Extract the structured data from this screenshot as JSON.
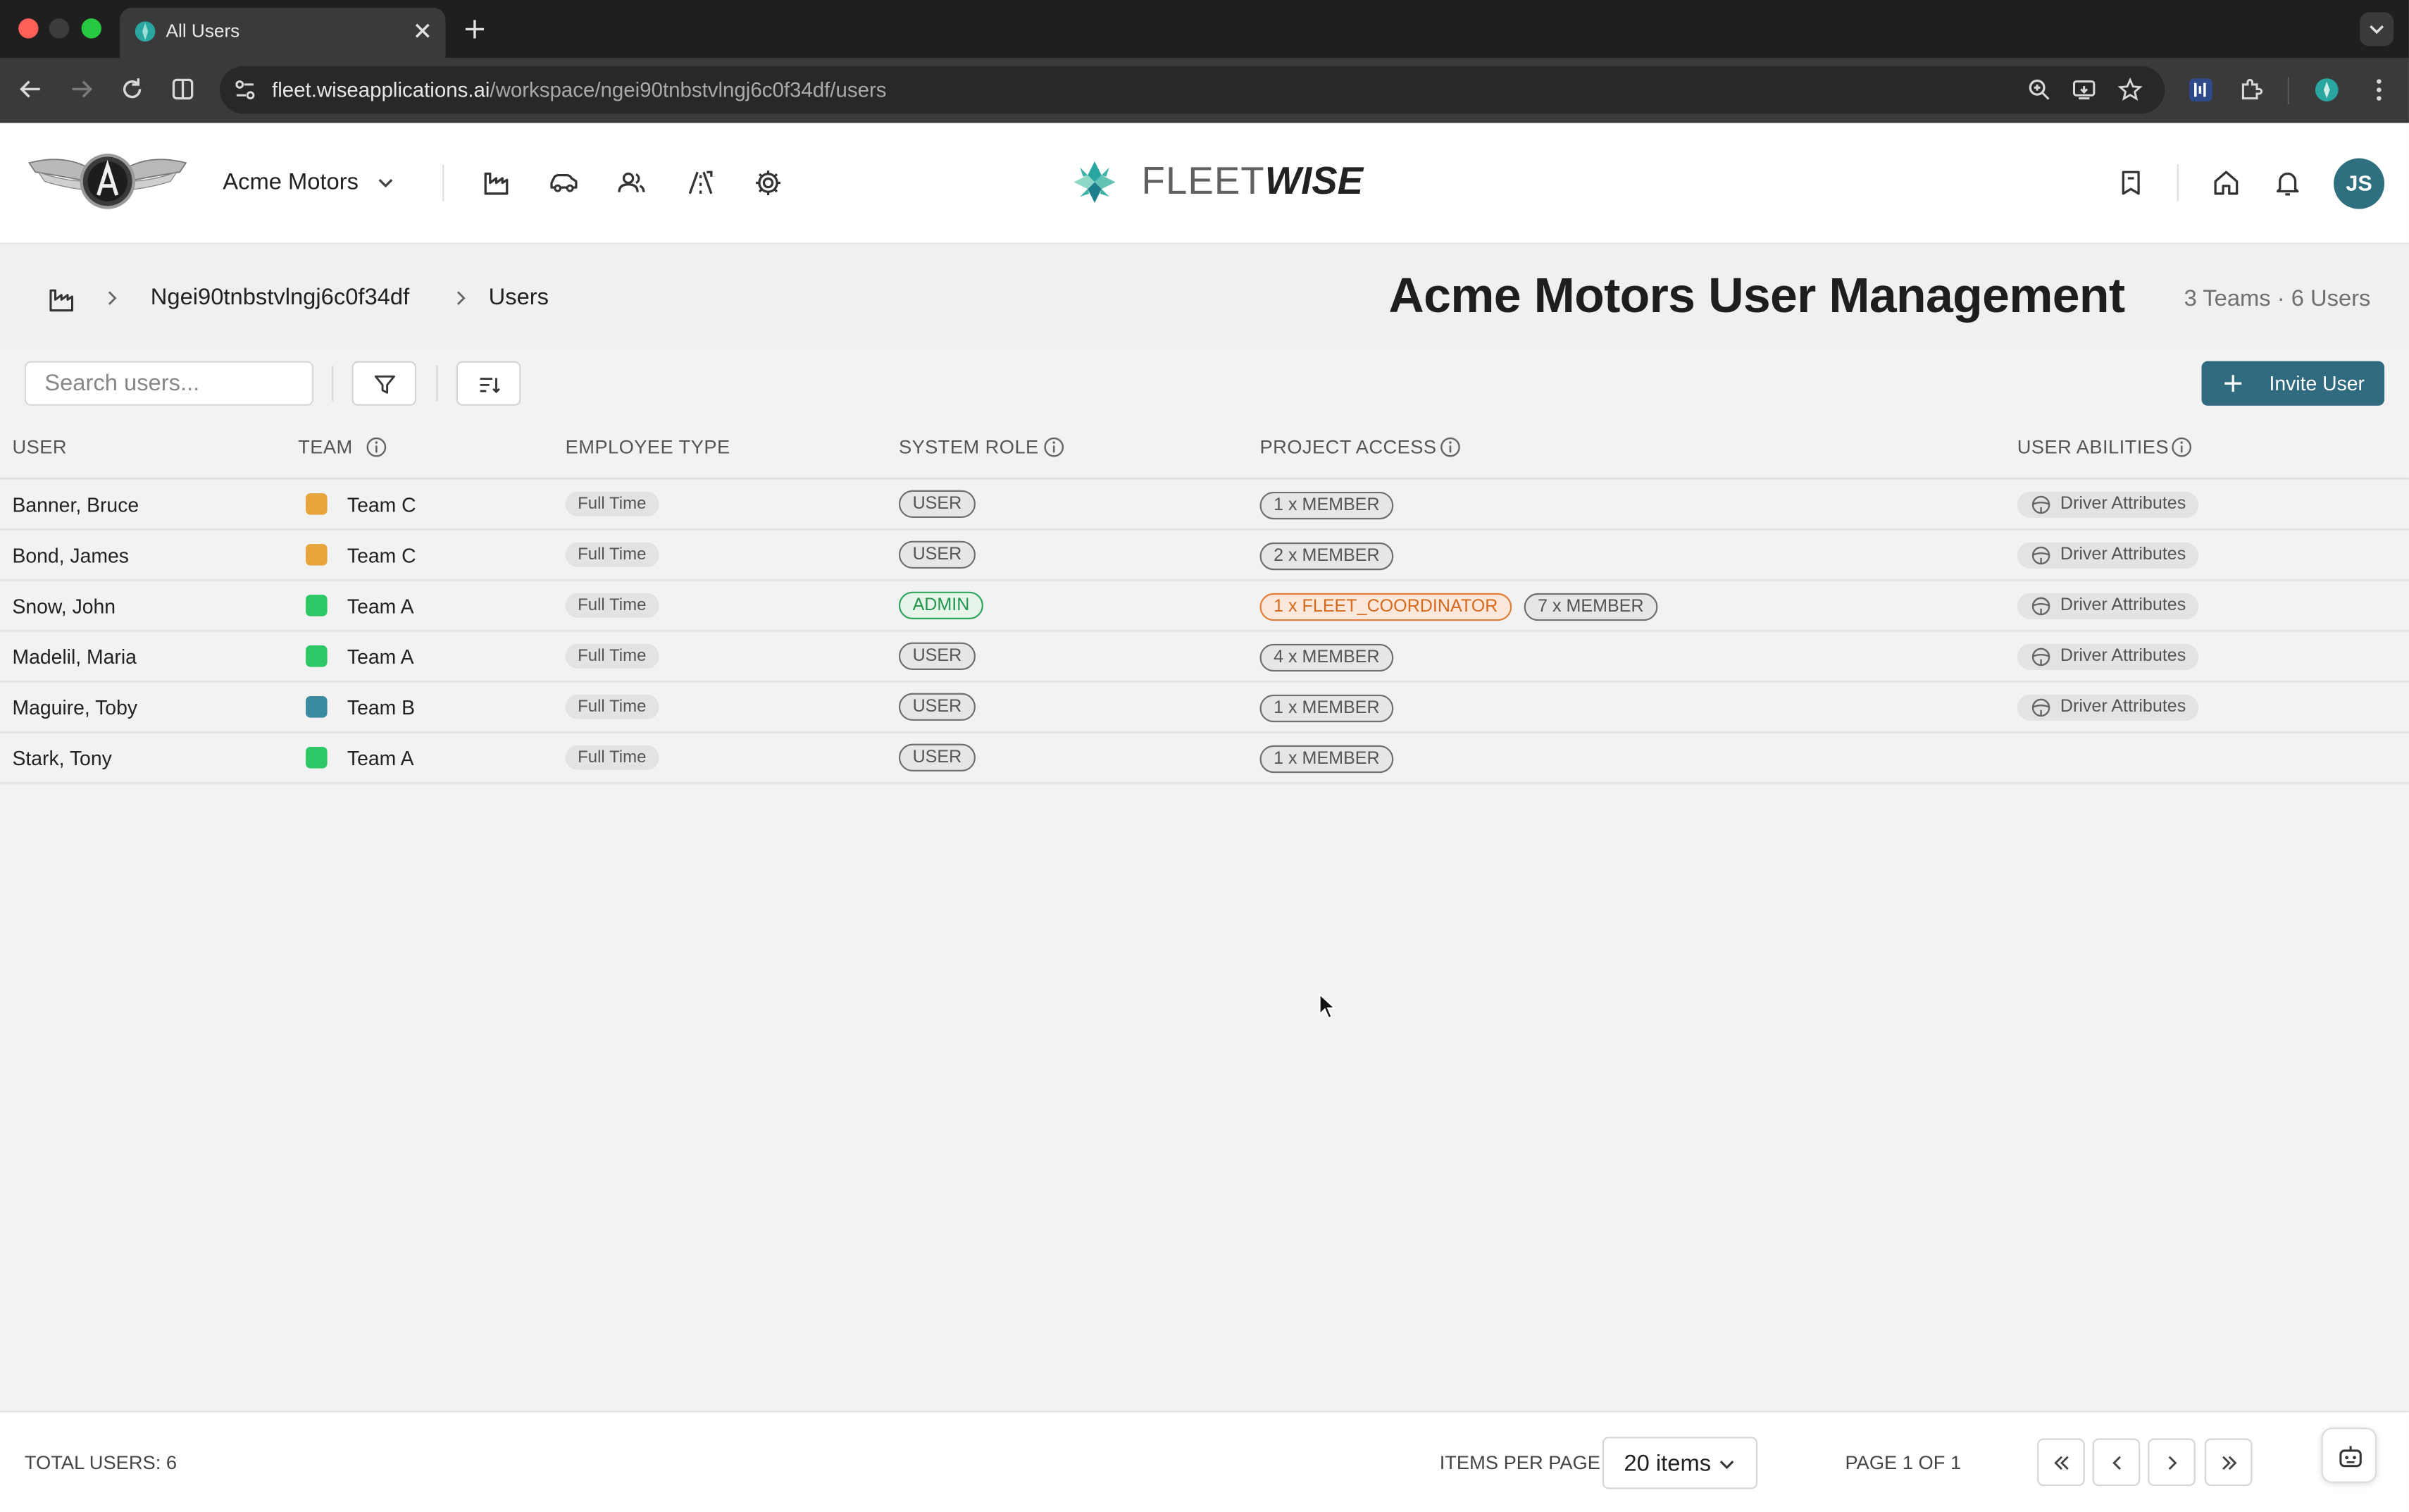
{
  "browser": {
    "tab_title": "All Users",
    "url_host": "fleet.wiseapplications.ai",
    "url_path": "/workspace/ngei90tnbstvlngj6c0f34df/users"
  },
  "header": {
    "org_name": "Acme Motors",
    "brand_light": "FLEET",
    "brand_bold": "WISE",
    "avatar_initials": "JS",
    "nav_icons": [
      "factory-icon",
      "car-icon",
      "users-icon",
      "route-icon",
      "gear-icon"
    ],
    "right_icons": [
      "bookmark-icon",
      "home-icon",
      "bell-icon"
    ]
  },
  "page": {
    "breadcrumb": [
      "Ngei90tnbstvlngj6c0f34df",
      "Users"
    ],
    "title": "Acme Motors User Management",
    "stats": "3 Teams · 6 Users"
  },
  "controls": {
    "search_placeholder": "Search users...",
    "search_value": "",
    "invite_label": "Invite User"
  },
  "table": {
    "headers": {
      "user": "USER",
      "team": "TEAM",
      "employee_type": "EMPLOYEE TYPE",
      "system_role": "SYSTEM ROLE",
      "project_access": "PROJECT ACCESS",
      "user_abilities": "USER ABILITIES"
    },
    "rows": [
      {
        "name": "Banner, Bruce",
        "team": "Team C",
        "team_color": "#e8a33a",
        "employee_type": "Full Time",
        "role": "USER",
        "projects": [
          "1 x MEMBER"
        ],
        "ability": "Driver Attributes"
      },
      {
        "name": "Bond, James",
        "team": "Team C",
        "team_color": "#e8a33a",
        "employee_type": "Full Time",
        "role": "USER",
        "projects": [
          "2 x MEMBER"
        ],
        "ability": "Driver Attributes"
      },
      {
        "name": "Snow, John",
        "team": "Team A",
        "team_color": "#2ec866",
        "employee_type": "Full Time",
        "role": "ADMIN",
        "projects": [
          "1 x FLEET_COORDINATOR",
          "7 x MEMBER"
        ],
        "ability": "Driver Attributes"
      },
      {
        "name": "Madelil, Maria",
        "team": "Team A",
        "team_color": "#2ec866",
        "employee_type": "Full Time",
        "role": "USER",
        "projects": [
          "4 x MEMBER"
        ],
        "ability": "Driver Attributes"
      },
      {
        "name": "Maguire, Toby",
        "team": "Team B",
        "team_color": "#3a8aa0",
        "employee_type": "Full Time",
        "role": "USER",
        "projects": [
          "1 x MEMBER"
        ],
        "ability": "Driver Attributes"
      },
      {
        "name": "Stark, Tony",
        "team": "Team A",
        "team_color": "#2ec866",
        "employee_type": "Full Time",
        "role": "USER",
        "projects": [
          "1 x MEMBER"
        ],
        "ability": ""
      }
    ]
  },
  "footer": {
    "total_users": "TOTAL USERS: 6",
    "items_per_page_label": "ITEMS PER PAGE",
    "items_per_page_value": "20 items",
    "page_indicator": "PAGE 1 OF 1"
  },
  "colors": {
    "accent": "#2f6a7e",
    "admin_green": "#22964f",
    "coordinator_orange": "#d7691f"
  }
}
